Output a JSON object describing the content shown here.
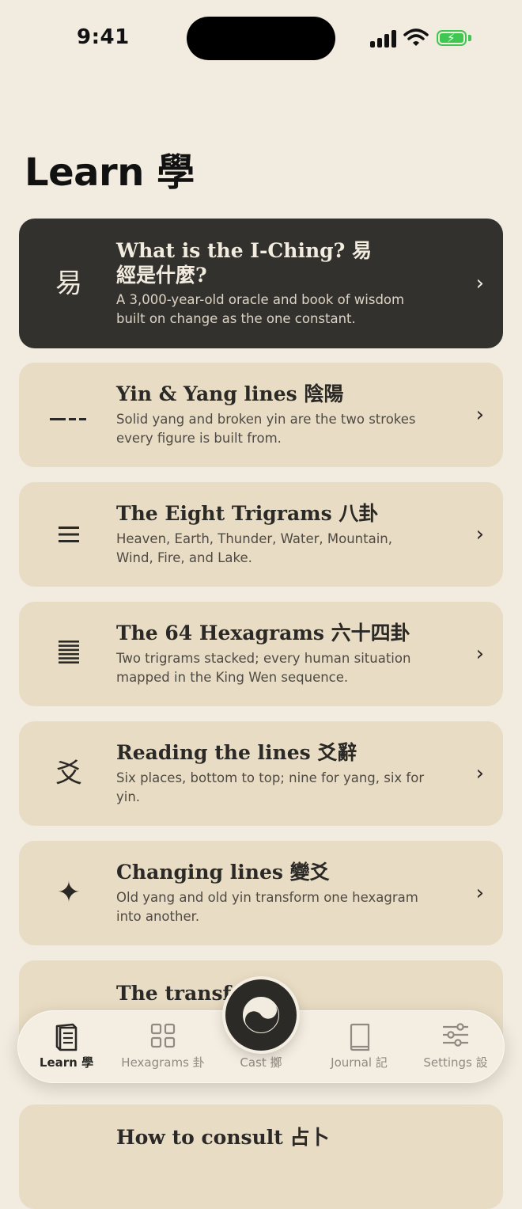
{
  "status_bar": {
    "time": "9:41"
  },
  "page": {
    "title": "Learn 學"
  },
  "cards": [
    {
      "glyph": "易",
      "title": "What is the I-Ching? 易經是什麼?",
      "description": "A 3,000-year-old oracle and book of wisdom built on change as the one constant."
    },
    {
      "glyph": "⚋",
      "title": "Yin & Yang lines 陰陽",
      "description": "Solid yang and broken yin are the two strokes every figure is built from."
    },
    {
      "glyph": "☰",
      "title": "The Eight Trigrams 八卦",
      "description": "Heaven, Earth, Thunder, Water, Mountain, Wind, Fire, and Lake."
    },
    {
      "glyph": "䷀",
      "title": "The 64 Hexagrams 六十四卦",
      "description": "Two trigrams stacked; every human situation mapped in the King Wen sequence."
    },
    {
      "glyph": "爻",
      "title": "Reading the lines 爻辭",
      "description": "Six places, bottom to top; nine for yang, six for yin."
    },
    {
      "glyph": "✦",
      "title": "Changing lines 變爻",
      "description": "Old yang and old yin transform one hexagram into another."
    },
    {
      "glyph": "",
      "title": "The transfo",
      "description": ""
    },
    {
      "glyph": "",
      "title": "How to consult 占卜",
      "description": ""
    }
  ],
  "tab_bar": {
    "tabs": [
      {
        "label": "Learn 學",
        "icon": "book-icon",
        "active": true
      },
      {
        "label": "Hexagrams 卦",
        "icon": "grid-icon",
        "active": false
      },
      {
        "label": "Cast 擲",
        "icon": "yin-yang-icon",
        "active": false
      },
      {
        "label": "Journal 記",
        "icon": "journal-icon",
        "active": false
      },
      {
        "label": "Settings 設",
        "icon": "sliders-icon",
        "active": false
      }
    ]
  },
  "colors": {
    "background": "#f2ebdf",
    "card": "#e9dcc4",
    "card_dark": "#33312d",
    "battery": "#3fc752"
  }
}
